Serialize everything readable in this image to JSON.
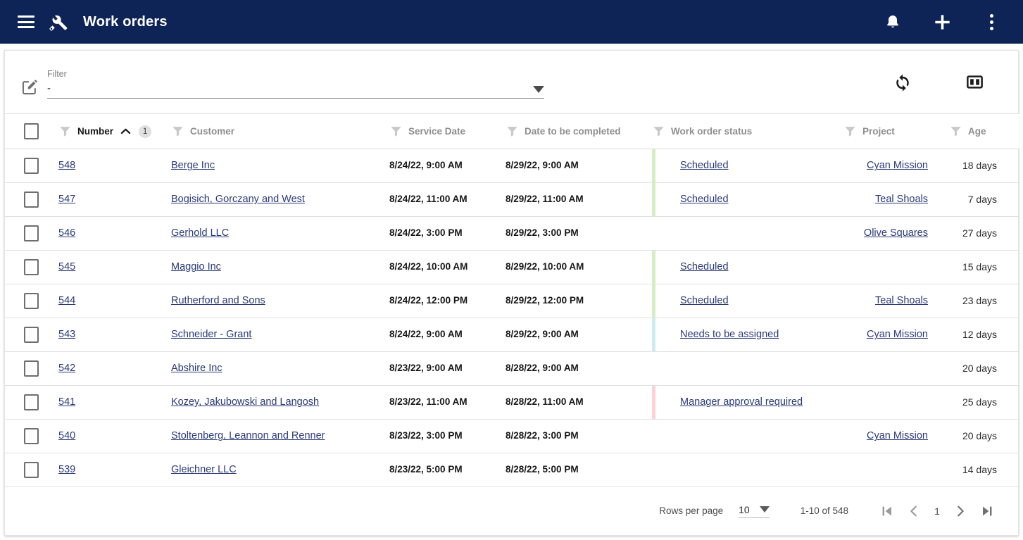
{
  "appbar": {
    "menu_icon": "hamburger-menu-icon",
    "brand_icon": "tools-icon",
    "title": "Work orders",
    "notifications_icon": "bell-icon",
    "add_icon": "plus-icon",
    "overflow_icon": "more-vertical-icon",
    "bg_color": "#0e2456"
  },
  "toolbar": {
    "edit_icon": "edit-square-icon",
    "filter_label": "Filter",
    "filter_value": "-",
    "dropdown_icon": "chevron-down-icon",
    "refresh_icon": "refresh-icon",
    "columns_icon": "column-layout-icon"
  },
  "table": {
    "select_all": "",
    "columns": [
      {
        "key": "number",
        "label": "Number",
        "sorted": true,
        "sort_dir": "asc",
        "sort_index": "1",
        "align": "left"
      },
      {
        "key": "customer",
        "label": "Customer",
        "sorted": false,
        "align": "left"
      },
      {
        "key": "service_date",
        "label": "Service Date",
        "sorted": false,
        "align": "left"
      },
      {
        "key": "due_date",
        "label": "Date to be completed",
        "sorted": false,
        "align": "left"
      },
      {
        "key": "status",
        "label": "Work order status",
        "sorted": false,
        "align": "left"
      },
      {
        "key": "project",
        "label": "Project",
        "sorted": false,
        "align": "right"
      },
      {
        "key": "age",
        "label": "Age",
        "sorted": false,
        "align": "right"
      }
    ],
    "rows": [
      {
        "number": "548",
        "customer": "Berge Inc",
        "service_date": "8/24/22, 9:00 AM",
        "due_date": "8/29/22, 9:00 AM",
        "status": "Scheduled",
        "status_color": "#d6efc2",
        "project": "Cyan Mission",
        "age": "18 days"
      },
      {
        "number": "547",
        "customer": "Bogisich, Gorczany and West",
        "service_date": "8/24/22, 11:00 AM",
        "due_date": "8/29/22, 11:00 AM",
        "status": "Scheduled",
        "status_color": "#d6efc2",
        "project": "Teal Shoals",
        "age": "7 days"
      },
      {
        "number": "546",
        "customer": "Gerhold LLC",
        "service_date": "8/24/22, 3:00 PM",
        "due_date": "8/29/22, 3:00 PM",
        "status": "",
        "status_color": "",
        "project": "Olive Squares",
        "age": "27 days"
      },
      {
        "number": "545",
        "customer": "Maggio Inc",
        "service_date": "8/24/22, 10:00 AM",
        "due_date": "8/29/22, 10:00 AM",
        "status": "Scheduled",
        "status_color": "#d6efc2",
        "project": "",
        "age": "15 days"
      },
      {
        "number": "544",
        "customer": "Rutherford and Sons",
        "service_date": "8/24/22, 12:00 PM",
        "due_date": "8/29/22, 12:00 PM",
        "status": "Scheduled",
        "status_color": "#d6efc2",
        "project": "Teal Shoals",
        "age": "23 days"
      },
      {
        "number": "543",
        "customer": "Schneider - Grant",
        "service_date": "8/24/22, 9:00 AM",
        "due_date": "8/29/22, 9:00 AM",
        "status": "Needs to be assigned",
        "status_color": "#cdecee",
        "project": "Cyan Mission",
        "age": "12 days"
      },
      {
        "number": "542",
        "customer": "Abshire Inc",
        "service_date": "8/23/22, 9:00 AM",
        "due_date": "8/28/22, 9:00 AM",
        "status": "",
        "status_color": "",
        "project": "",
        "age": "20 days"
      },
      {
        "number": "541",
        "customer": "Kozey, Jakubowski and Langosh",
        "service_date": "8/23/22, 11:00 AM",
        "due_date": "8/28/22, 11:00 AM",
        "status": "Manager approval required",
        "status_color": "#fbd2d6",
        "project": "",
        "age": "25 days"
      },
      {
        "number": "540",
        "customer": "Stoltenberg, Leannon and Renner",
        "service_date": "8/23/22, 3:00 PM",
        "due_date": "8/28/22, 3:00 PM",
        "status": "",
        "status_color": "",
        "project": "Cyan Mission",
        "age": "20 days"
      },
      {
        "number": "539",
        "customer": "Gleichner LLC",
        "service_date": "8/23/22, 5:00 PM",
        "due_date": "8/28/22, 5:00 PM",
        "status": "",
        "status_color": "",
        "project": "",
        "age": "14 days"
      }
    ]
  },
  "pagination": {
    "rows_per_page_label": "Rows per page",
    "rows_per_page_value": "10",
    "range_text": "1-10 of 548",
    "current_page": "1",
    "first_icon": "first-page-icon",
    "prev_icon": "previous-page-icon",
    "next_icon": "next-page-icon",
    "last_icon": "last-page-icon"
  },
  "colors": {
    "navy": "#0e2456",
    "link": "#2b3a78",
    "status_scheduled": "#d6efc2",
    "status_needs_assign": "#cdecee",
    "status_manager_approval": "#fbd2d6"
  }
}
